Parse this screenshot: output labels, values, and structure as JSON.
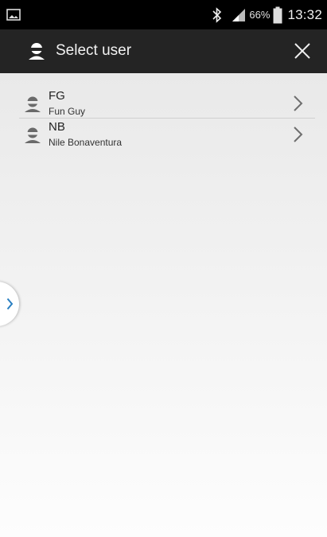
{
  "status_bar": {
    "battery_percent": "66%",
    "time": "13:32",
    "icons": [
      "gallery-notification-icon",
      "bluetooth-icon",
      "signal-icon",
      "battery-icon"
    ]
  },
  "action_bar": {
    "title": "Select user",
    "icons": [
      "user-icon",
      "close-icon"
    ]
  },
  "users": [
    {
      "initials": "FG",
      "name": "Fun Guy"
    },
    {
      "initials": "NB",
      "name": "Nile Bonaventura"
    }
  ],
  "drawer": {
    "icon": "chevron-right-icon"
  },
  "colors": {
    "status_bar": "#000000",
    "action_bar": "#242424",
    "drawer_chevron": "#2a7fc1"
  }
}
